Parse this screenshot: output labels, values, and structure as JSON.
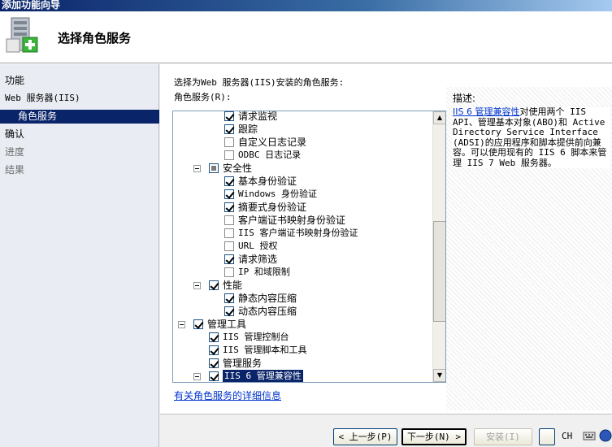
{
  "window": {
    "title": "添加功能向导"
  },
  "header": {
    "title": "选择角色服务"
  },
  "nav": {
    "items": [
      {
        "label": "功能",
        "state": "normal"
      },
      {
        "label": "Web 服务器(IIS)",
        "state": "normal"
      },
      {
        "label": "角色服务",
        "state": "selected"
      },
      {
        "label": "确认",
        "state": "normal"
      },
      {
        "label": "进度",
        "state": "muted"
      },
      {
        "label": "结果",
        "state": "muted"
      }
    ]
  },
  "content": {
    "instruction": "选择为Web 服务器(IIS)安装的角色服务:",
    "list_label": "角色服务(R):",
    "detail_link": "有关角色服务的详细信息"
  },
  "tree": {
    "rows": [
      {
        "label": "请求监视",
        "state": "checked",
        "level": 3,
        "expander": false
      },
      {
        "label": "跟踪",
        "state": "checked",
        "level": 3,
        "expander": false
      },
      {
        "label": "自定义日志记录",
        "state": "unchecked",
        "level": 3,
        "expander": false
      },
      {
        "label": "ODBC 日志记录",
        "state": "unchecked",
        "level": 3,
        "expander": false
      },
      {
        "label": "安全性",
        "state": "partial",
        "level": 2,
        "expander": true
      },
      {
        "label": "基本身份验证",
        "state": "checked",
        "level": 3,
        "expander": false
      },
      {
        "label": "Windows 身份验证",
        "state": "checked",
        "level": 3,
        "expander": false
      },
      {
        "label": "摘要式身份验证",
        "state": "checked",
        "level": 3,
        "expander": false
      },
      {
        "label": "客户端证书映射身份验证",
        "state": "unchecked",
        "level": 3,
        "expander": false
      },
      {
        "label": "IIS 客户端证书映射身份验证",
        "state": "unchecked",
        "level": 3,
        "expander": false
      },
      {
        "label": "URL 授权",
        "state": "unchecked",
        "level": 3,
        "expander": false
      },
      {
        "label": "请求筛选",
        "state": "checked",
        "level": 3,
        "expander": false
      },
      {
        "label": "IP 和域限制",
        "state": "unchecked",
        "level": 3,
        "expander": false
      },
      {
        "label": "性能",
        "state": "checked",
        "level": 2,
        "expander": true
      },
      {
        "label": "静态内容压缩",
        "state": "checked",
        "level": 3,
        "expander": false
      },
      {
        "label": "动态内容压缩",
        "state": "checked",
        "level": 3,
        "expander": false
      },
      {
        "label": "管理工具",
        "state": "checked",
        "level": 1,
        "expander": true
      },
      {
        "label": "IIS 管理控制台",
        "state": "checked",
        "level": 2,
        "expander": false
      },
      {
        "label": "IIS 管理脚本和工具",
        "state": "checked",
        "level": 2,
        "expander": false
      },
      {
        "label": "管理服务",
        "state": "checked",
        "level": 2,
        "expander": false
      },
      {
        "label": "IIS 6 管理兼容性",
        "state": "checked",
        "level": 2,
        "expander": true,
        "selected": true
      }
    ]
  },
  "description": {
    "title": "描述:",
    "link": "IIS 6 管理兼容性",
    "text": "对使用两个 IIS API、管理基本对象(ABO)和 Active Directory Service Interface (ADSI)的应用程序和脚本提供前向兼容。可以使用现有的 IIS 6 脚本来管理 IIS 7 Web 服务器。"
  },
  "footer": {
    "back": "< 上一步(P)",
    "next": "下一步(N) >",
    "install": "安装(I)",
    "ime": "CH"
  },
  "colors": {
    "selection": "#0a246a",
    "link": "#0033cc",
    "nav_bg": "#e9ecf2"
  }
}
